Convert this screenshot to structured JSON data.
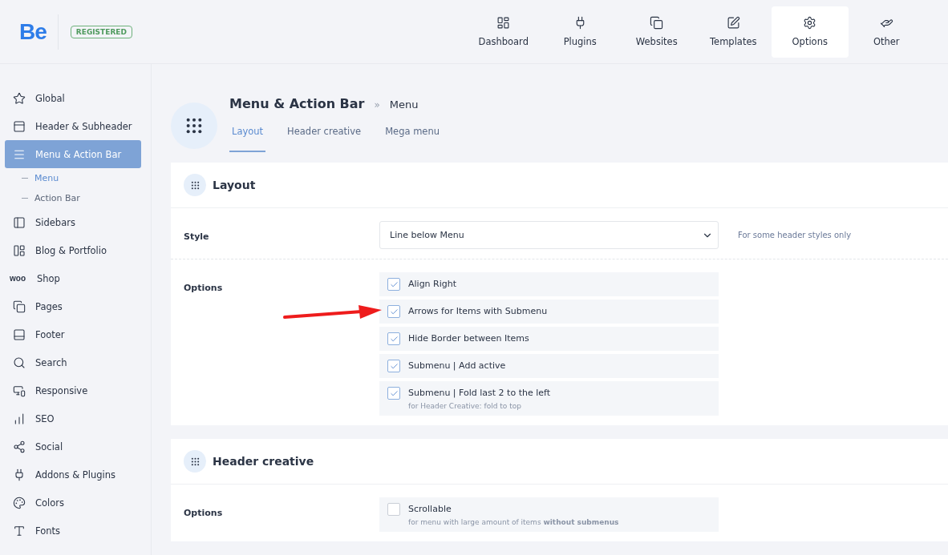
{
  "brand": {
    "logo": "Be",
    "badge": "REGISTERED"
  },
  "nav": [
    {
      "label": "Dashboard",
      "selected": false
    },
    {
      "label": "Plugins",
      "selected": false
    },
    {
      "label": "Websites",
      "selected": false
    },
    {
      "label": "Templates",
      "selected": false
    },
    {
      "label": "Options",
      "selected": true
    },
    {
      "label": "Other",
      "selected": false
    }
  ],
  "sidebar": {
    "items": [
      {
        "label": "Global",
        "selected": false
      },
      {
        "label": "Header & Subheader",
        "selected": false
      },
      {
        "label": "Menu & Action Bar",
        "selected": true,
        "children": [
          {
            "label": "Menu",
            "selected": true
          },
          {
            "label": "Action Bar",
            "selected": false
          }
        ]
      },
      {
        "label": "Sidebars",
        "selected": false
      },
      {
        "label": "Blog & Portfolio",
        "selected": false
      },
      {
        "label": "Shop",
        "selected": false,
        "icon_text": "woo"
      },
      {
        "label": "Pages",
        "selected": false
      },
      {
        "label": "Footer",
        "selected": false
      },
      {
        "label": "Search",
        "selected": false
      },
      {
        "label": "Responsive",
        "selected": false
      },
      {
        "label": "SEO",
        "selected": false
      },
      {
        "label": "Social",
        "selected": false
      },
      {
        "label": "Addons & Plugins",
        "selected": false
      },
      {
        "label": "Colors",
        "selected": false
      },
      {
        "label": "Fonts",
        "selected": false
      }
    ]
  },
  "page": {
    "title": "Menu & Action Bar",
    "separator": "»",
    "crumb": "Menu",
    "tabs": [
      {
        "label": "Layout",
        "selected": true
      },
      {
        "label": "Header creative",
        "selected": false
      },
      {
        "label": "Mega menu",
        "selected": false
      }
    ]
  },
  "sections": [
    {
      "title": "Layout",
      "rows": [
        {
          "kind": "select",
          "label": "Style",
          "value": "Line below Menu",
          "note": "For some header styles only"
        },
        {
          "kind": "checks",
          "label": "Options",
          "options": [
            {
              "label": "Align Right",
              "checked": true
            },
            {
              "label": "Arrows for Items with Submenu",
              "checked": true
            },
            {
              "label": "Hide Border between Items",
              "checked": true
            },
            {
              "label": "Submenu | Add active",
              "checked": true
            },
            {
              "label": "Submenu | Fold last 2 to the left",
              "checked": true,
              "hint": "for Header Creative: fold to top"
            }
          ]
        }
      ]
    },
    {
      "title": "Header creative",
      "rows": [
        {
          "kind": "checks",
          "label": "Options",
          "options": [
            {
              "label": "Scrollable",
              "checked": false,
              "hint": "for menu with large amount of items **without submenus**"
            }
          ]
        }
      ]
    }
  ]
}
